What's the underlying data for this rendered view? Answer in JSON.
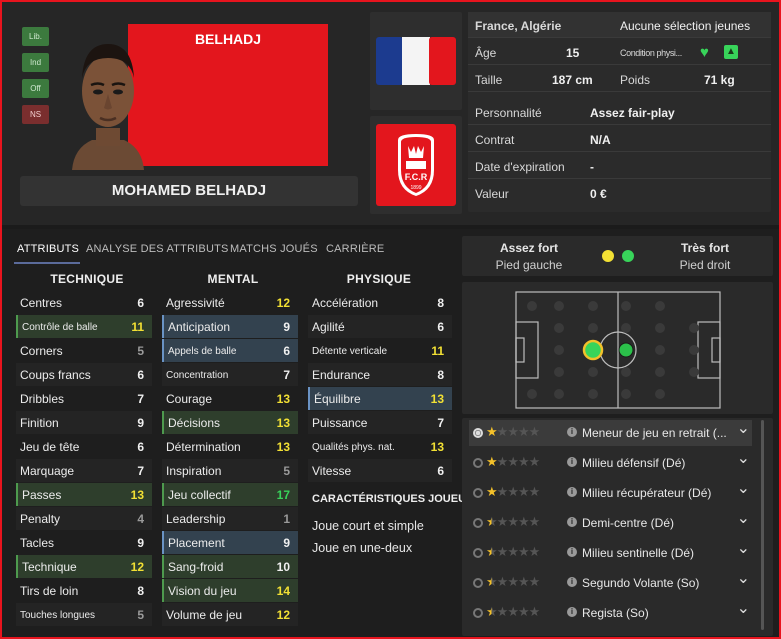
{
  "header": {
    "badges": [
      "Lib.",
      "Ind",
      "Off",
      "NS"
    ],
    "banner_name": "BELHADJ",
    "player_name": "MOHAMED BELHADJ"
  },
  "info": {
    "nationality": "France, Algérie",
    "youth_selection": "Aucune sélection jeunes",
    "age_label": "Âge",
    "age_value": "15",
    "condition_label": "Condition physi...",
    "height_label": "Taille",
    "height_value": "187 cm",
    "weight_label": "Poids",
    "weight_value": "71 kg",
    "personality_label": "Personnalité",
    "personality_value": "Assez fair-play",
    "contract_label": "Contrat",
    "contract_value": "N/A",
    "expiry_label": "Date d'expiration",
    "expiry_value": "-",
    "value_label": "Valeur",
    "value_value": "0 €"
  },
  "club_crest": {
    "letters": "F.C.R",
    "year": "1899"
  },
  "tabs": [
    "ATTRIBUTS",
    "ANALYSE DES ATTRIBUTS",
    "MATCHS JOUÉS",
    "CARRIÈRE"
  ],
  "columns": {
    "technique": "TECHNIQUE",
    "mental": "MENTAL",
    "physique": "PHYSIQUE"
  },
  "technique": [
    {
      "name": "Centres",
      "value": "6"
    },
    {
      "name": "Contrôle de balle",
      "value": "11"
    },
    {
      "name": "Corners",
      "value": "5"
    },
    {
      "name": "Coups francs",
      "value": "6"
    },
    {
      "name": "Dribbles",
      "value": "7"
    },
    {
      "name": "Finition",
      "value": "9"
    },
    {
      "name": "Jeu de tête",
      "value": "6"
    },
    {
      "name": "Marquage",
      "value": "7"
    },
    {
      "name": "Passes",
      "value": "13"
    },
    {
      "name": "Penalty",
      "value": "4"
    },
    {
      "name": "Tacles",
      "value": "9"
    },
    {
      "name": "Technique",
      "value": "12"
    },
    {
      "name": "Tirs de loin",
      "value": "8"
    },
    {
      "name": "Touches longues",
      "value": "5"
    }
  ],
  "mental": [
    {
      "name": "Agressivité",
      "value": "12"
    },
    {
      "name": "Anticipation",
      "value": "9"
    },
    {
      "name": "Appels de balle",
      "value": "6"
    },
    {
      "name": "Concentration",
      "value": "7"
    },
    {
      "name": "Courage",
      "value": "13"
    },
    {
      "name": "Décisions",
      "value": "13"
    },
    {
      "name": "Détermination",
      "value": "13"
    },
    {
      "name": "Inspiration",
      "value": "5"
    },
    {
      "name": "Jeu collectif",
      "value": "17"
    },
    {
      "name": "Leadership",
      "value": "1"
    },
    {
      "name": "Placement",
      "value": "9"
    },
    {
      "name": "Sang-froid",
      "value": "10"
    },
    {
      "name": "Vision du jeu",
      "value": "14"
    },
    {
      "name": "Volume de jeu",
      "value": "12"
    }
  ],
  "physique": [
    {
      "name": "Accélération",
      "value": "8"
    },
    {
      "name": "Agilité",
      "value": "6"
    },
    {
      "name": "Détente verticale",
      "value": "11"
    },
    {
      "name": "Endurance",
      "value": "8"
    },
    {
      "name": "Équilibre",
      "value": "13"
    },
    {
      "name": "Puissance",
      "value": "7"
    },
    {
      "name": "Qualités phys. nat.",
      "value": "13"
    },
    {
      "name": "Vitesse",
      "value": "6"
    }
  ],
  "traits": {
    "title": "CARACTÉRISTIQUES JOUEUR",
    "items": [
      "Joue court et simple",
      "Joue en une-deux"
    ]
  },
  "feet": {
    "left_level": "Assez fort",
    "left_label": "Pied gauche",
    "right_level": "Très fort",
    "right_label": "Pied droit"
  },
  "roles": [
    {
      "name": "Meneur de jeu en retrait (...",
      "stars": 1
    },
    {
      "name": "Milieu défensif (Dé)",
      "stars": 1
    },
    {
      "name": "Milieu récupérateur (Dé)",
      "stars": 1
    },
    {
      "name": "Demi-centre (Dé)",
      "stars": 0.5
    },
    {
      "name": "Milieu sentinelle (Dé)",
      "stars": 0.5
    },
    {
      "name": "Segundo Volante (So)",
      "stars": 0.5
    },
    {
      "name": "Regista (So)",
      "stars": 0.5
    }
  ],
  "colors": {
    "accent_red": "#e3161d",
    "highlight_yellow": "#f2e034",
    "highlight_green": "#38d45a"
  }
}
